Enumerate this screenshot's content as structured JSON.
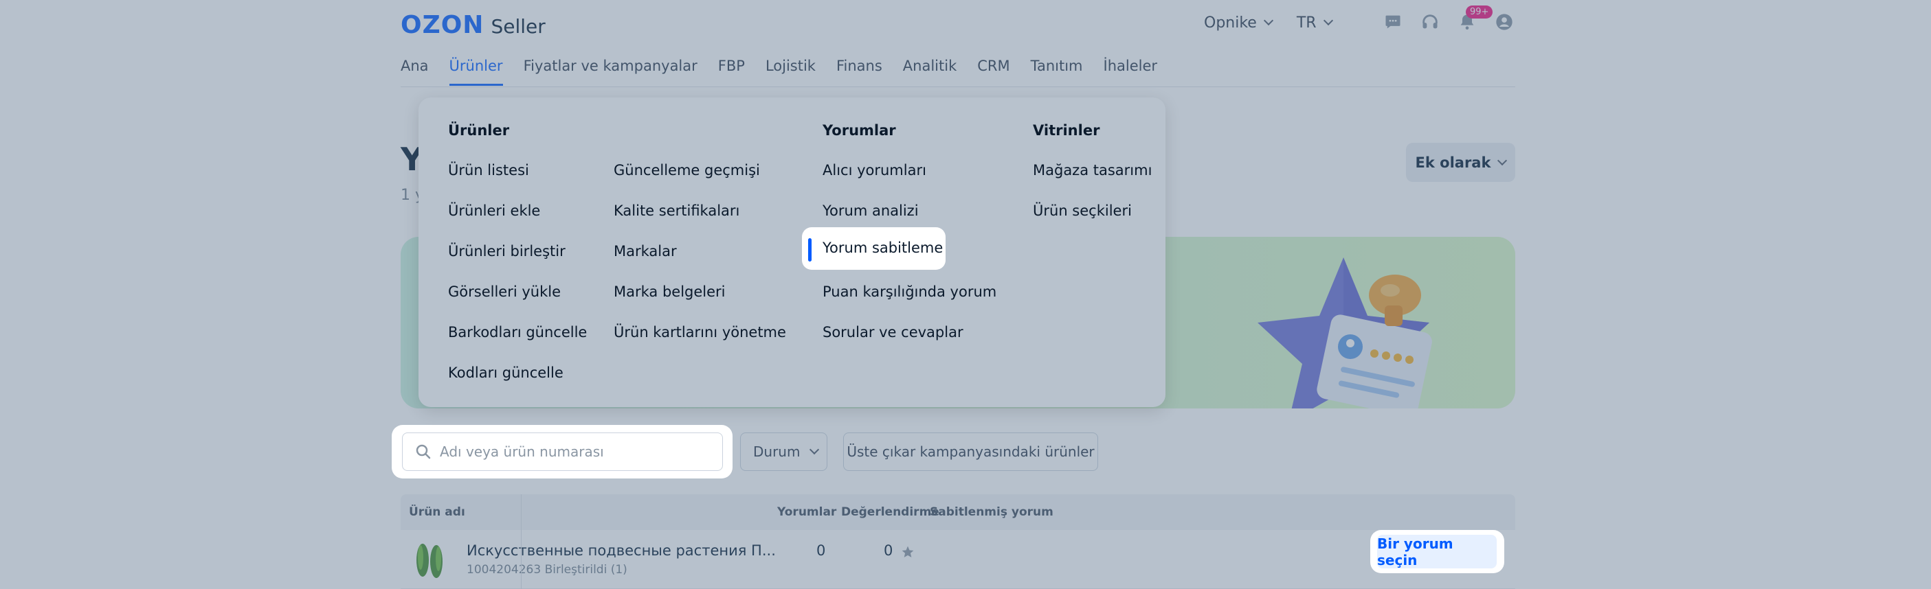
{
  "logo": {
    "brand": "OZON",
    "suffix": "Seller"
  },
  "header": {
    "company": "Opnike",
    "language": "TR",
    "notifications_badge": "99+",
    "icons": [
      "chat-icon",
      "headset-icon",
      "bell-icon",
      "user-icon"
    ]
  },
  "tabs": [
    {
      "label": "Ana"
    },
    {
      "label": "Ürünler",
      "active": true
    },
    {
      "label": "Fiyatlar ve kampanyalar"
    },
    {
      "label": "FBP"
    },
    {
      "label": "Lojistik"
    },
    {
      "label": "Finans"
    },
    {
      "label": "Analitik"
    },
    {
      "label": "CRM"
    },
    {
      "label": "Tanıtım"
    },
    {
      "label": "İhaleler"
    }
  ],
  "page": {
    "title_partial": "Y",
    "subtitle_partial": "1 y",
    "more_button": "Ek olarak"
  },
  "menu": {
    "col1": {
      "title": "Ürünler",
      "items": [
        "Ürün listesi",
        "Ürünleri ekle",
        "Ürünleri birleştir",
        "Görselleri yükle",
        "Barkodları güncelle",
        "Kodları güncelle"
      ]
    },
    "col2": {
      "items": [
        "Güncelleme geçmişi",
        "Kalite sertifikaları",
        "Markalar",
        "Marka belgeleri",
        "Ürün kartlarını yönetme"
      ]
    },
    "col3": {
      "title": "Yorumlar",
      "items": [
        "Alıcı yorumları",
        "Yorum analizi",
        "Yorum sabitleme",
        "Puan karşılığında yorum",
        "Sorular ve cevaplar"
      ],
      "selected": "Yorum sabitleme"
    },
    "col4": {
      "title": "Vitrinler",
      "items": [
        "Mağaza tasarımı",
        "Ürün seçkileri"
      ]
    }
  },
  "filters": {
    "search_placeholder": "Adı veya ürün numarası",
    "status_label": "Durum",
    "promo_button": "Üste çıkar kampanyasındaki ürünler"
  },
  "table": {
    "columns": [
      "Ürün adı",
      "Yorumlar",
      "Değerlendirme",
      "Sabitlenmiş yorum"
    ],
    "rows": [
      {
        "name": "Искусственные подвесные растения П...",
        "meta": "1004204263 Birleştirildi (1)",
        "reviews": "0",
        "rating": "0",
        "action": "Bir yorum seçin"
      }
    ]
  },
  "colors": {
    "accent": "#005bff",
    "badge": "#f1117e",
    "overlay": "#5f758f"
  }
}
